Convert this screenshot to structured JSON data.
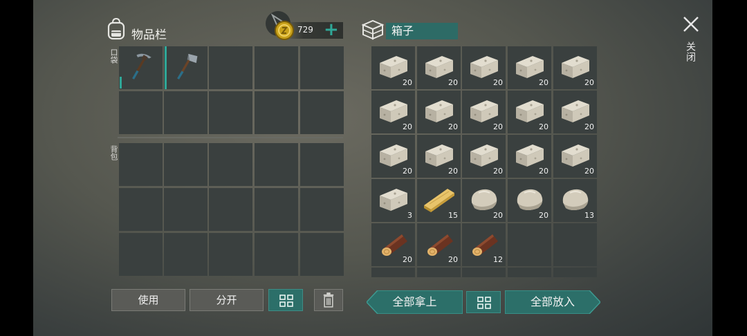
{
  "inventory": {
    "title": "物品栏",
    "pocket_label": "口袋",
    "backpack_label": "背包",
    "pocket_items": [
      {
        "icon": "pickaxe-icon"
      },
      {
        "icon": "hatchet-icon"
      }
    ]
  },
  "currency": {
    "amount": "729",
    "add": "+"
  },
  "chest": {
    "title": "箱子",
    "items": [
      {
        "icon": "stone-block-icon",
        "qty": "20"
      },
      {
        "icon": "stone-block-icon",
        "qty": "20"
      },
      {
        "icon": "stone-block-icon",
        "qty": "20"
      },
      {
        "icon": "stone-block-icon",
        "qty": "20"
      },
      {
        "icon": "stone-block-icon",
        "qty": "20"
      },
      {
        "icon": "stone-block-icon",
        "qty": "20"
      },
      {
        "icon": "stone-block-icon",
        "qty": "20"
      },
      {
        "icon": "stone-block-icon",
        "qty": "20"
      },
      {
        "icon": "stone-block-icon",
        "qty": "20"
      },
      {
        "icon": "stone-block-icon",
        "qty": "20"
      },
      {
        "icon": "stone-block-icon",
        "qty": "20"
      },
      {
        "icon": "stone-block-icon",
        "qty": "20"
      },
      {
        "icon": "stone-block-icon",
        "qty": "20"
      },
      {
        "icon": "stone-block-icon",
        "qty": "20"
      },
      {
        "icon": "stone-block-icon",
        "qty": "20"
      },
      {
        "icon": "stone-block-icon",
        "qty": "3"
      },
      {
        "icon": "wood-plank-icon",
        "qty": "15"
      },
      {
        "icon": "stone-icon",
        "qty": "20"
      },
      {
        "icon": "stone-icon",
        "qty": "20"
      },
      {
        "icon": "stone-icon",
        "qty": "13"
      },
      {
        "icon": "log-icon",
        "qty": "20"
      },
      {
        "icon": "log-icon",
        "qty": "20"
      },
      {
        "icon": "log-icon",
        "qty": "12"
      }
    ]
  },
  "buttons": {
    "use": "使用",
    "split": "分开",
    "take_all": "全部拿上",
    "put_all": "全部放入"
  },
  "close": {
    "label": "关闭"
  },
  "colors": {
    "accent": "#2fa898",
    "slot": "#3a403f",
    "button_teal": "#2c6f69"
  }
}
